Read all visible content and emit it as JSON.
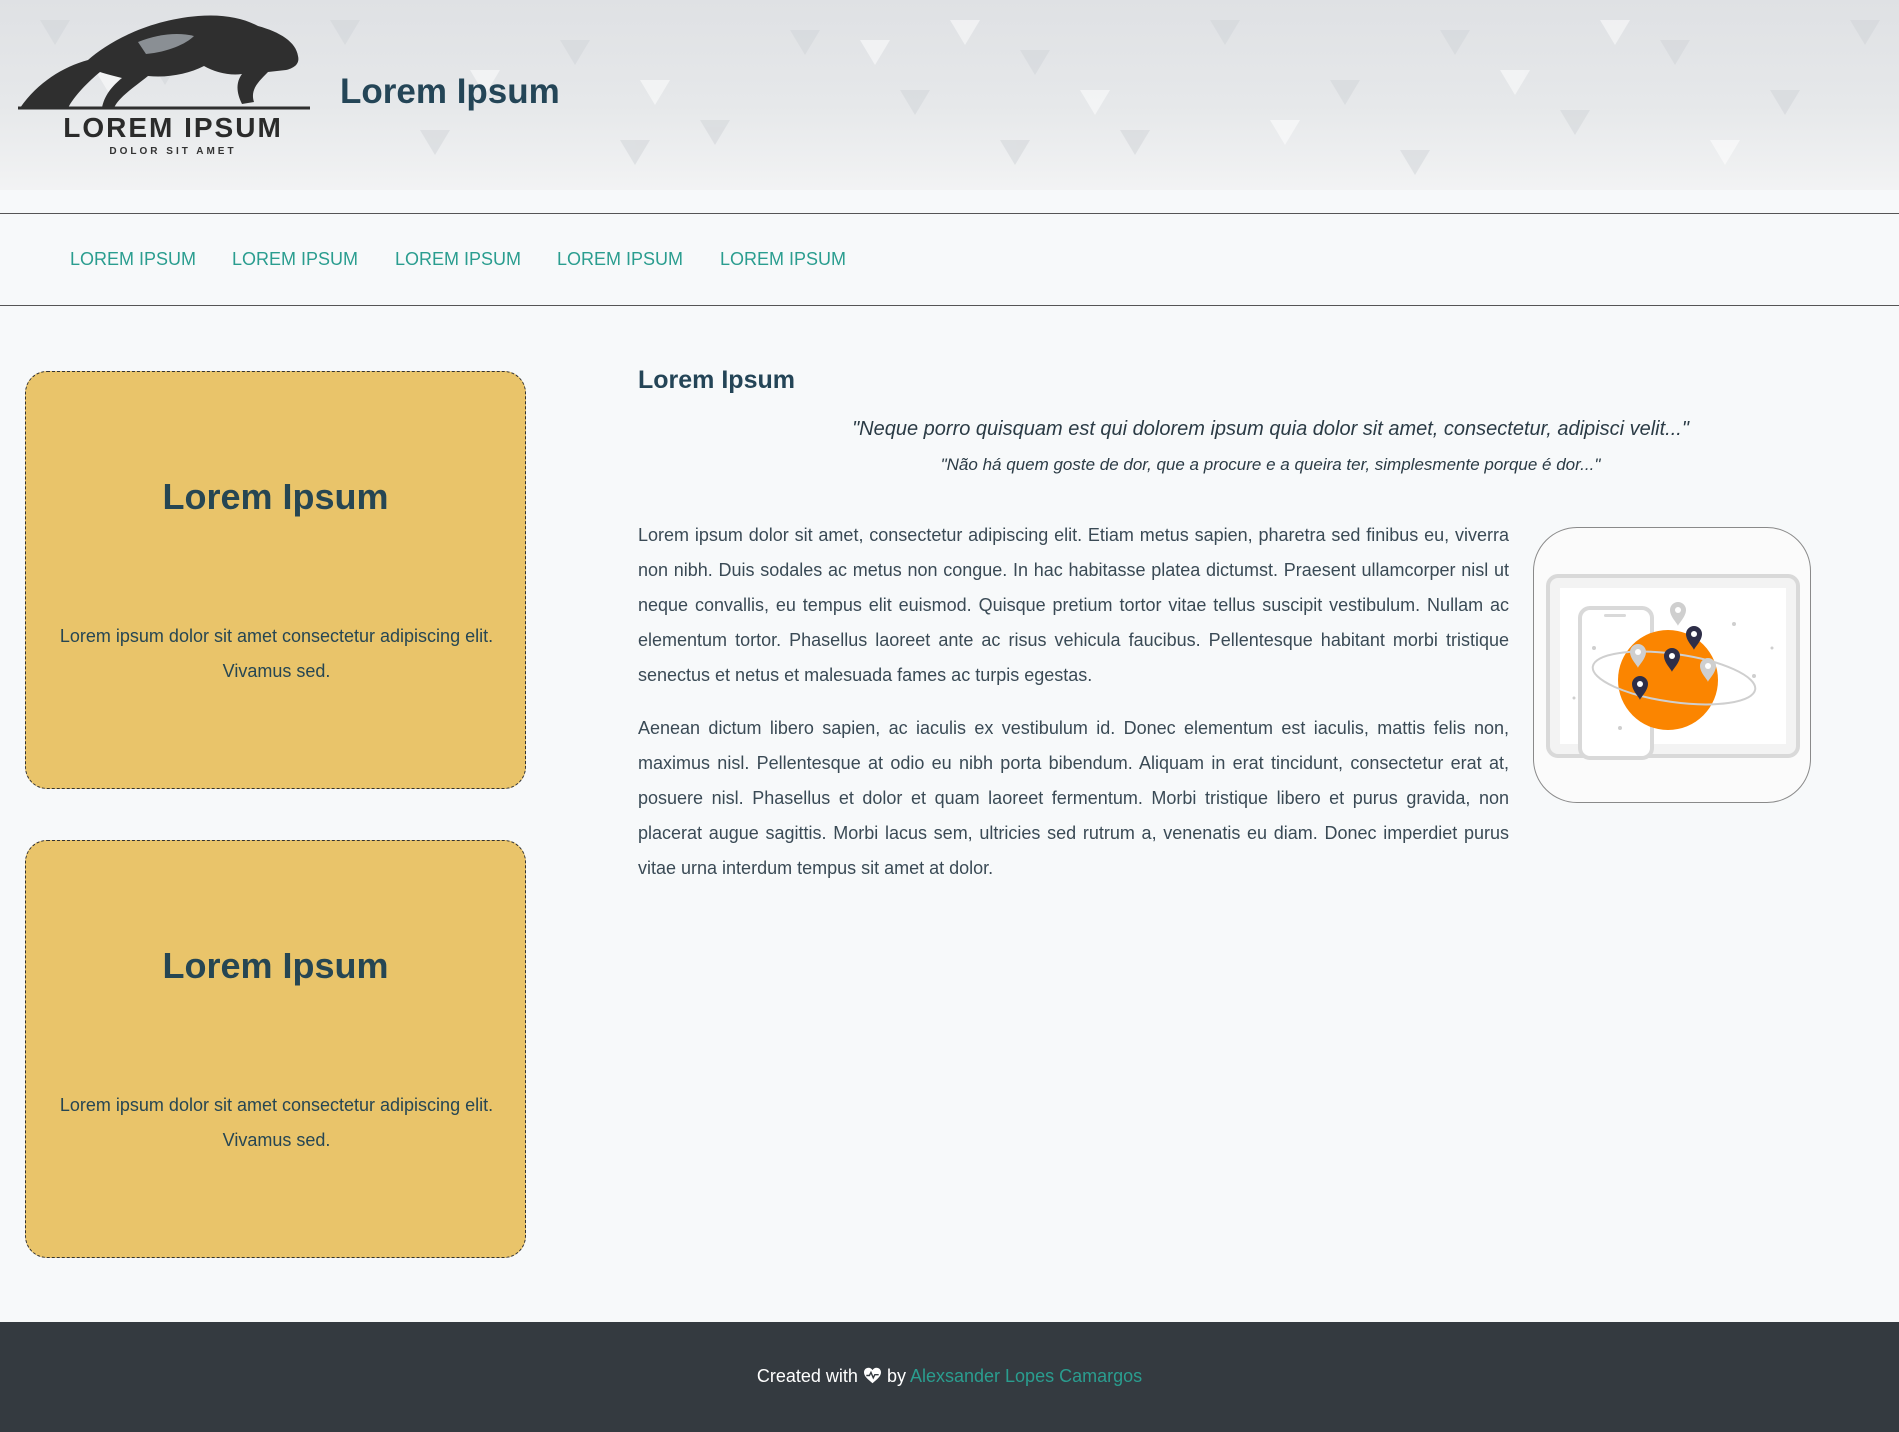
{
  "header": {
    "logo": {
      "title": "LOREM IPSUM",
      "subtitle": "DOLOR SIT AMET",
      "icon": "panther-icon"
    },
    "site_title": "Lorem Ipsum"
  },
  "nav": {
    "items": [
      {
        "label": "LOREM IPSUM"
      },
      {
        "label": "LOREM IPSUM"
      },
      {
        "label": "LOREM IPSUM"
      },
      {
        "label": "LOREM IPSUM"
      },
      {
        "label": "LOREM IPSUM"
      }
    ]
  },
  "cards": [
    {
      "title": "Lorem Ipsum",
      "text": "Lorem ipsum dolor sit amet consectetur adipiscing elit. Vivamus sed."
    },
    {
      "title": "Lorem Ipsum",
      "text": "Lorem ipsum dolor sit amet consectetur adipiscing elit. Vivamus sed."
    }
  ],
  "main": {
    "title": "Lorem Ipsum",
    "quote_latin": "\"Neque porro quisquam est qui dolorem ipsum quia dolor sit amet, consectetur, adipisci velit...\"",
    "quote_portuguese": "\"Não há quem goste de dor, que a procure e a queira ter, simplesmente porque é dor...\"",
    "paragraphs": [
      "Lorem ipsum dolor sit amet, consectetur adipiscing elit. Etiam metus sapien, pharetra sed finibus eu, viverra non nibh. Duis sodales ac metus non congue. In hac habitasse platea dictumst. Praesent ullamcorper nisl ut neque convallis, eu tempus elit euismod. Quisque pretium tortor vitae tellus suscipit vestibulum. Nullam ac elementum tortor. Phasellus laoreet ante ac risus vehicula faucibus. Pellentesque habitant morbi tristique senectus et netus et malesuada fames ac turpis egestas.",
      "Aenean dictum libero sapien, ac iaculis ex vestibulum id. Donec elementum est iaculis, mattis felis non, maximus nisl. Pellentesque at odio eu nibh porta bibendum. Aliquam in erat tincidunt, consectetur erat at, posuere nisl. Phasellus et dolor et quam laoreet fermentum. Morbi tristique libero et purus gravida, non placerat augue sagittis. Morbi lacus sem, ultricies sed rutrum a, venenatis eu diam. Donec imperdiet purus vitae urna interdum tempus sit amet at dolor."
    ],
    "illustration": "map-location-illustration"
  },
  "footer": {
    "created_with": "Created with",
    "icon": "heart-icon",
    "by": "by",
    "author": "Alexsander Lopes Camargos"
  },
  "colors": {
    "accent": "#2a9d8f",
    "card": "#e9c46a",
    "dark_text": "#264653",
    "footer_bg": "#343a40",
    "illustration_orange": "#fb8500"
  }
}
